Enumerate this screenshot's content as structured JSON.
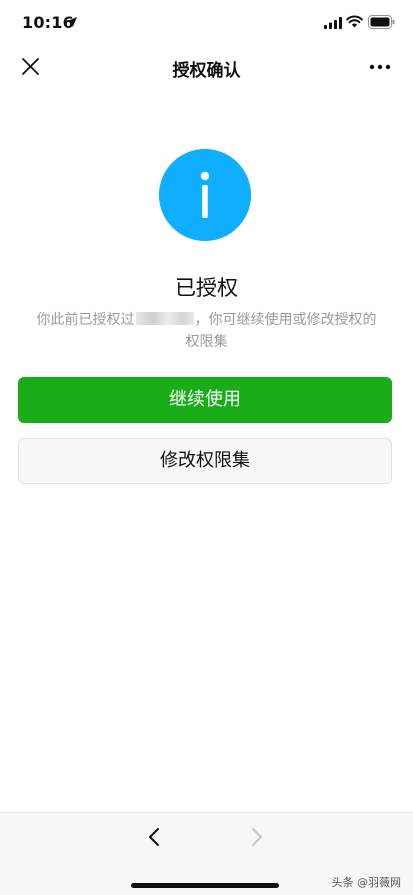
{
  "status_bar": {
    "time": "10:16"
  },
  "nav": {
    "title": "授权确认"
  },
  "auth": {
    "title": "已授权",
    "desc_prefix": "你此前已授权过",
    "desc_suffix": "，你可继续使用或修改授权的权限集"
  },
  "buttons": {
    "continue_label": "继续使用",
    "modify_label": "修改权限集"
  },
  "watermark": "头条 @羽薇网",
  "colors": {
    "info_blue": "#10aeff",
    "primary_green": "#1aad19"
  },
  "icons": {
    "close": "close-icon",
    "more": "more-icon",
    "info": "info-icon",
    "back": "chevron-left-icon",
    "forward": "chevron-right-icon"
  }
}
